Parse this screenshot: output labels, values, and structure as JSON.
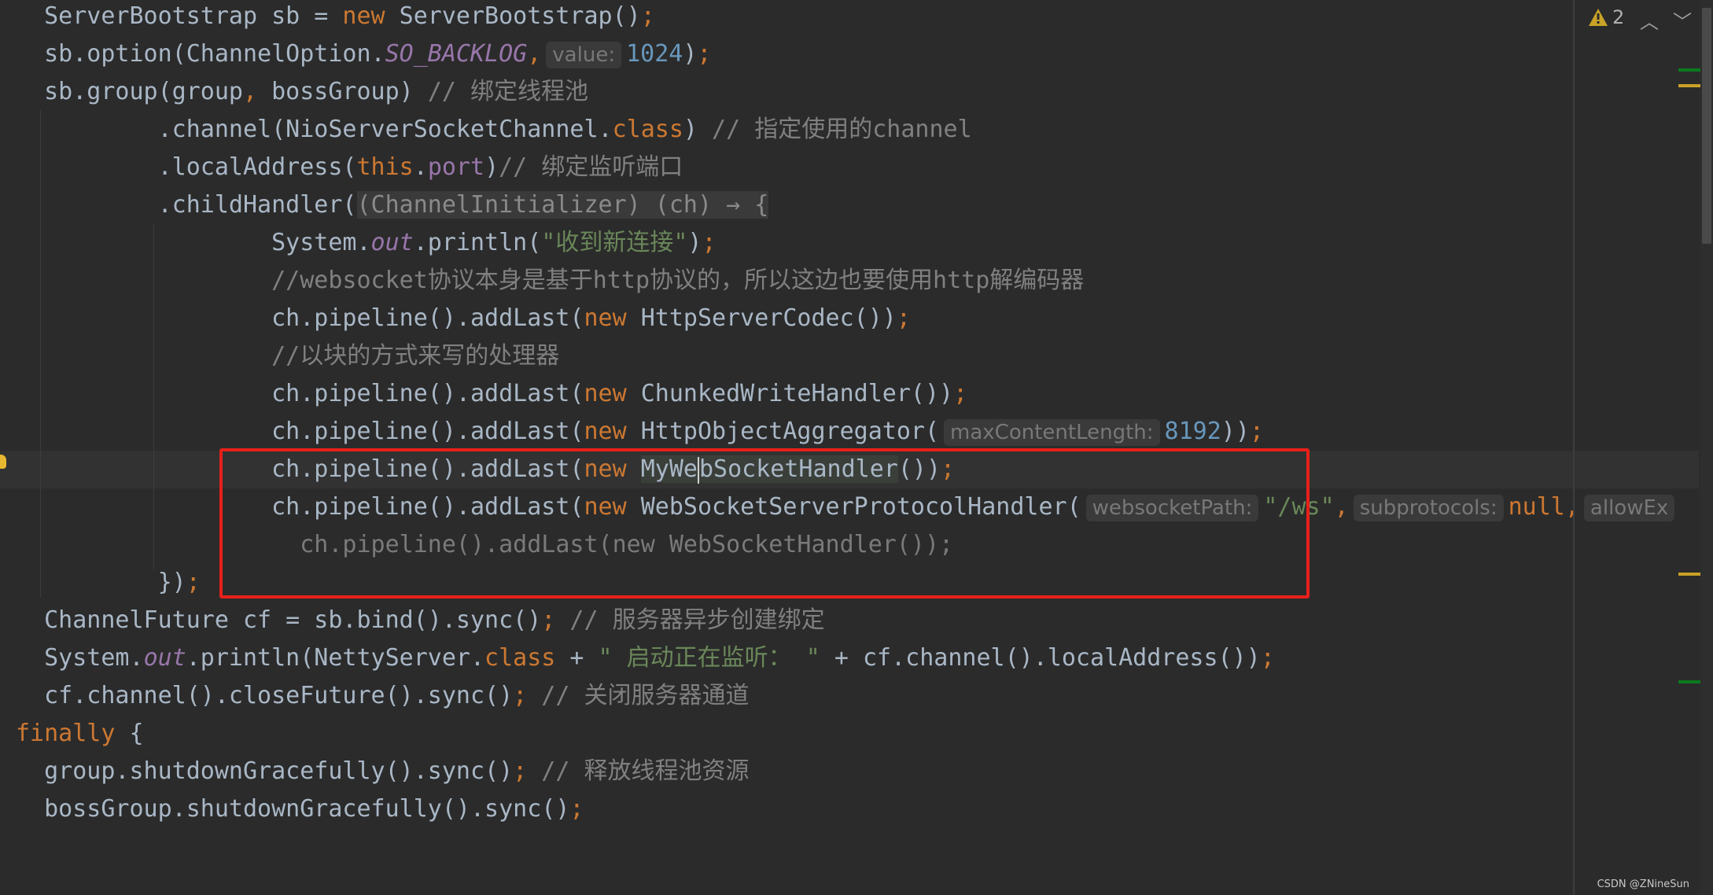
{
  "colors": {
    "background": "#2b2b2b",
    "keyword": "#cc7832",
    "string": "#6a8759",
    "comment": "#808080",
    "field": "#9876aa",
    "number": "#6897bb",
    "highlight_box": "#e8201a"
  },
  "inspection": {
    "icon": "warning-icon",
    "count": "2",
    "prev_icon": "chevron-up-icon",
    "next_icon": "chevron-down-icon"
  },
  "watermark": "CSDN @ZNineSun",
  "code": [
    {
      "indent": 2,
      "tokens": [
        [
          "ServerBootstrap sb = ",
          "p"
        ],
        [
          "new",
          "k"
        ],
        [
          " ServerBootstrap()",
          "p"
        ],
        [
          ";",
          "k"
        ]
      ]
    },
    {
      "indent": 2,
      "tokens": [
        [
          "sb.option(ChannelOption.",
          "p"
        ],
        [
          "SO_BACKLOG",
          "f"
        ],
        [
          ",",
          "k"
        ],
        [
          "value:",
          "h"
        ],
        [
          "1024",
          "n"
        ],
        [
          ")",
          "p"
        ],
        [
          ";",
          "k"
        ]
      ]
    },
    {
      "indent": 2,
      "tokens": [
        [
          "sb.group(group",
          "p"
        ],
        [
          ",",
          "k"
        ],
        [
          " bossGroup) ",
          "p"
        ],
        [
          "// 绑定线程池",
          "c"
        ]
      ]
    },
    {
      "indent": 10,
      "tokens": [
        [
          ".channel(NioServerSocketChannel.",
          "p"
        ],
        [
          "class",
          "k"
        ],
        [
          ") ",
          "p"
        ],
        [
          "// 指定使用的channel",
          "c"
        ]
      ]
    },
    {
      "indent": 10,
      "tokens": [
        [
          ".localAddress(",
          "p"
        ],
        [
          "this",
          "k"
        ],
        [
          ".",
          "p"
        ],
        [
          "port",
          "fd"
        ],
        [
          ")",
          "p"
        ],
        [
          "// 绑定监听端口",
          "c"
        ]
      ]
    },
    {
      "indent": 10,
      "tokens": [
        [
          ".childHandler(",
          "p"
        ],
        [
          "(ChannelInitializer) (ch) → {",
          "fold"
        ]
      ]
    },
    {
      "indent": 18,
      "tokens": [
        [
          "System.",
          "p"
        ],
        [
          "out",
          "f"
        ],
        [
          ".println(",
          "p"
        ],
        [
          "\"收到新连接\"",
          "s"
        ],
        [
          ")",
          "p"
        ],
        [
          ";",
          "k"
        ]
      ]
    },
    {
      "indent": 18,
      "tokens": [
        [
          "//websocket协议本身是基于http协议的，所以这边也要使用http解编码器",
          "c"
        ]
      ]
    },
    {
      "indent": 18,
      "tokens": [
        [
          "ch.pipeline().addLast(",
          "p"
        ],
        [
          "new",
          "k"
        ],
        [
          " HttpServerCodec())",
          "p"
        ],
        [
          ";",
          "k"
        ]
      ]
    },
    {
      "indent": 18,
      "tokens": [
        [
          "//以块的方式来写的处理器",
          "c"
        ]
      ]
    },
    {
      "indent": 18,
      "tokens": [
        [
          "ch.pipeline().addLast(",
          "p"
        ],
        [
          "new",
          "k"
        ],
        [
          " ChunkedWriteHandler())",
          "p"
        ],
        [
          ";",
          "k"
        ]
      ]
    },
    {
      "indent": 18,
      "tokens": [
        [
          "ch.pipeline().addLast(",
          "p"
        ],
        [
          "new",
          "k"
        ],
        [
          " HttpObjectAggregator(",
          "p"
        ],
        [
          "maxContentLength:",
          "h"
        ],
        [
          "8192",
          "n"
        ],
        [
          "))",
          "p"
        ],
        [
          ";",
          "k"
        ]
      ]
    },
    {
      "indent": 18,
      "current": true,
      "tokens": [
        [
          "ch.pipeline().addLast(",
          "p"
        ],
        [
          "new",
          "k"
        ],
        [
          " ",
          "p"
        ],
        [
          "MyWe",
          "usage"
        ],
        [
          "|",
          "caret"
        ],
        [
          "bSocketHandler",
          "usage"
        ],
        [
          "())",
          "p"
        ],
        [
          ";",
          "k"
        ]
      ]
    },
    {
      "indent": 18,
      "tokens": [
        [
          "ch.pipeline().addLast(",
          "p"
        ],
        [
          "new",
          "k"
        ],
        [
          " WebSocketServerProtocolHandler(",
          "p"
        ],
        [
          "websocketPath:",
          "h"
        ],
        [
          "\"/ws\"",
          "s"
        ],
        [
          ",",
          "k"
        ],
        [
          "subprotocols:",
          "h"
        ],
        [
          "null",
          "k"
        ],
        [
          ",",
          "k"
        ],
        [
          "allowEx",
          "h"
        ]
      ]
    },
    {
      "indent": 20,
      "tokens": [
        [
          "ch.pipeline().addLast(new WebSocketHandler());",
          "ghost"
        ]
      ]
    },
    {
      "indent": 10,
      "tokens": [
        [
          "})",
          "p"
        ],
        [
          ";",
          "k"
        ]
      ]
    },
    {
      "indent": 2,
      "tokens": [
        [
          "ChannelFuture cf = sb.bind().sync()",
          "p"
        ],
        [
          ";",
          "k"
        ],
        [
          " // 服务器异步创建绑定",
          "c"
        ]
      ]
    },
    {
      "indent": 2,
      "tokens": [
        [
          "System.",
          "p"
        ],
        [
          "out",
          "f"
        ],
        [
          ".println(NettyServer.",
          "p"
        ],
        [
          "class",
          "k"
        ],
        [
          " + ",
          "p"
        ],
        [
          "\" 启动正在监听： \"",
          "s"
        ],
        [
          " + cf.channel().localAddress())",
          "p"
        ],
        [
          ";",
          "k"
        ]
      ]
    },
    {
      "indent": 2,
      "tokens": [
        [
          "cf.channel().closeFuture().sync()",
          "p"
        ],
        [
          ";",
          "k"
        ],
        [
          " // 关闭服务器通道",
          "c"
        ]
      ]
    },
    {
      "indent": 0,
      "tokens": [
        [
          "finally",
          "k"
        ],
        [
          " {",
          "p"
        ]
      ]
    },
    {
      "indent": 2,
      "tokens": [
        [
          "group.shutdownGracefully().sync()",
          "p"
        ],
        [
          ";",
          "k"
        ],
        [
          " // 释放线程池资源",
          "c"
        ]
      ]
    },
    {
      "indent": 2,
      "tokens": [
        [
          "bossGroup.shutdownGracefully().sync()",
          "p"
        ],
        [
          ";",
          "k"
        ]
      ]
    }
  ]
}
